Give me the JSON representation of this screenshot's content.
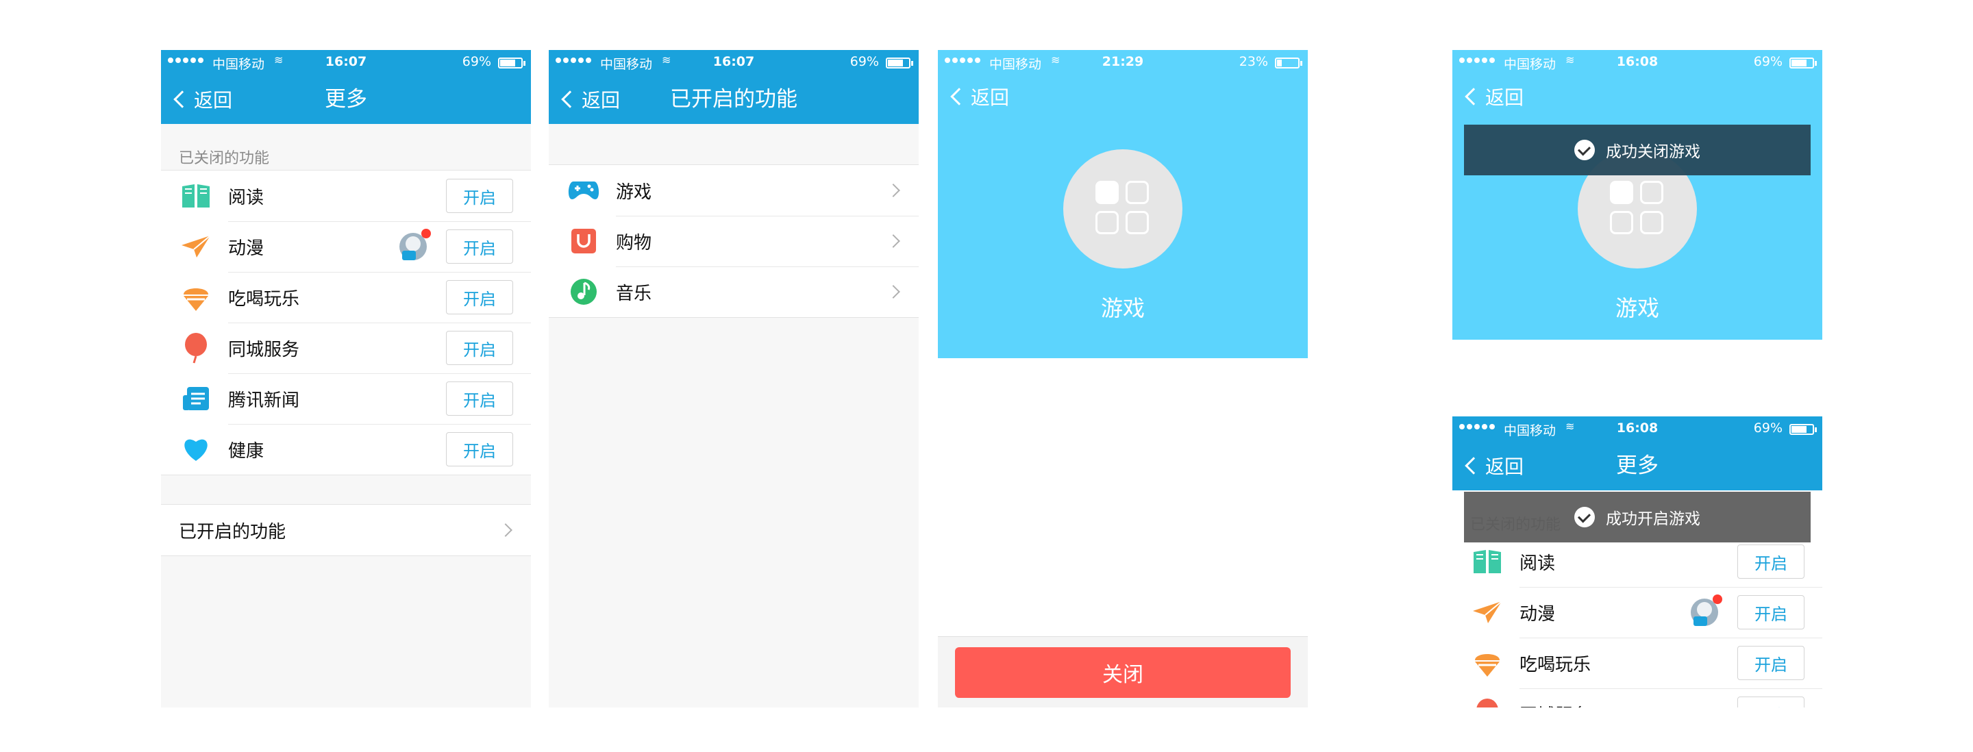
{
  "status": {
    "carrier": "中国移动",
    "s1_time": "16:07",
    "s1_batt": "69%",
    "s1_batt_level": 0.69,
    "s3_time": "21:29",
    "s3_batt": "23%",
    "s3_batt_level": 0.23,
    "s4_time": "16:08",
    "s4_batt": "69%"
  },
  "common": {
    "back_label": "返回",
    "open_label": "开启"
  },
  "screen_more": {
    "title": "更多",
    "closed_section_label": "已关闭的功能",
    "items": [
      {
        "label": "阅读",
        "icon": "book-icon"
      },
      {
        "label": "动漫",
        "icon": "paper-plane-icon"
      },
      {
        "label": "吃喝玩乐",
        "icon": "ice-cream-icon"
      },
      {
        "label": "同城服务",
        "icon": "balloon-icon"
      },
      {
        "label": "腾讯新闻",
        "icon": "news-icon"
      },
      {
        "label": "健康",
        "icon": "heart-icon"
      }
    ],
    "enabled_link_label": "已开启的功能"
  },
  "screen_enabled": {
    "title": "已开启的功能",
    "items": [
      {
        "label": "游戏",
        "icon": "gamepad-icon"
      },
      {
        "label": "购物",
        "icon": "shopping-bag-icon"
      },
      {
        "label": "音乐",
        "icon": "music-icon"
      }
    ]
  },
  "screen_game": {
    "name": "游戏",
    "close_label": "关闭"
  },
  "toasts": {
    "closed": "成功关闭游戏",
    "opened": "成功开启游戏"
  },
  "colors": {
    "brand_blue": "#1aa2dc",
    "hero_blue": "#5cd4fd",
    "danger": "#ff5c55"
  }
}
